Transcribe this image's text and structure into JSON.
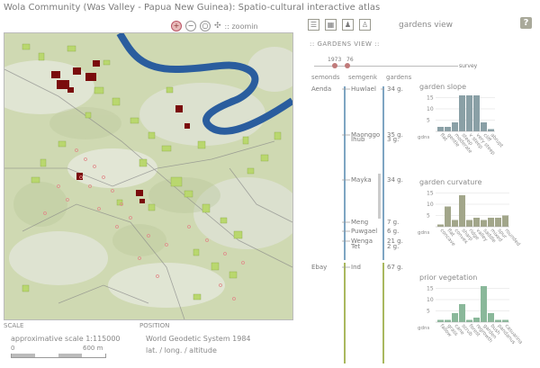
{
  "title": "Wola Community (Was Valley - Papua New Guinea): Spatio-cultural interactive atlas",
  "zoom_label": ":: zoomin",
  "help_label": "?",
  "gardens_view_title": "gardens view",
  "panel_heading": ":: GARDENS VIEW ::",
  "timeline": {
    "years": [
      "1973",
      "76"
    ],
    "end_label": "survey"
  },
  "columns": {
    "c1": "semonds",
    "c2": "semgenk",
    "c3": "gardens"
  },
  "rows": [
    {
      "left": "Aenda",
      "name": "Huwlael",
      "count": "34 g."
    },
    {
      "left": "",
      "name": "Maonggo",
      "count": "35 g."
    },
    {
      "left": "",
      "name": "Ihub",
      "count": "3 g."
    },
    {
      "left": "",
      "name": "Mayka",
      "count": "34 g."
    },
    {
      "left": "",
      "name": "Meng",
      "count": "7 g."
    },
    {
      "left": "",
      "name": "Puwgael",
      "count": "6 g."
    },
    {
      "left": "",
      "name": "Wenga",
      "count": "21 g."
    },
    {
      "left": "",
      "name": "Tet",
      "count": "2 g."
    },
    {
      "left": "Ebay",
      "name": "Ind",
      "count": "67 g."
    }
  ],
  "histograms": [
    {
      "title": "garden slope",
      "color": "#8aa0a6",
      "ylabels": [
        "15",
        "10",
        "5"
      ],
      "axis_label": "gdns",
      "values": [
        2,
        2,
        4,
        16,
        16,
        16,
        4,
        1
      ],
      "xlabels": [
        "flat",
        "gentle",
        "moderate",
        "steep",
        "v steep",
        "very steep",
        "cliff",
        "abrupt"
      ]
    },
    {
      "title": "garden curvature",
      "color": "#a2a68a",
      "ylabels": [
        "15",
        "10",
        "5"
      ],
      "axis_label": "gdns",
      "values": [
        1,
        9,
        3,
        14,
        3,
        4,
        3,
        4,
        4,
        5
      ],
      "xlabels": [
        "concave",
        "flat",
        "convex",
        "sharp",
        "ridge",
        "valley",
        "saddle",
        "mixed",
        "spur",
        "rounded"
      ]
    },
    {
      "title": "prior vegetation",
      "color": "#8ab89a",
      "ylabels": [
        "15",
        "10",
        "5"
      ],
      "axis_label": "gdns",
      "values": [
        1,
        1,
        4,
        8,
        1,
        2,
        16,
        4,
        1,
        1
      ],
      "xlabels": [
        "fallow",
        "grass",
        "cane",
        "scrub",
        "forest",
        "regrowth",
        "garden",
        "bush",
        "pandanus",
        "casuarina"
      ]
    }
  ],
  "footer": {
    "scale_head": "SCALE",
    "scale_text": "approximative scale 1:115000",
    "scale_min": "0",
    "scale_max": "600 m",
    "position_head": "POSITION",
    "position_sys": "World Geodetic System 1984",
    "position_fields": "lat. / long. / altitude"
  }
}
